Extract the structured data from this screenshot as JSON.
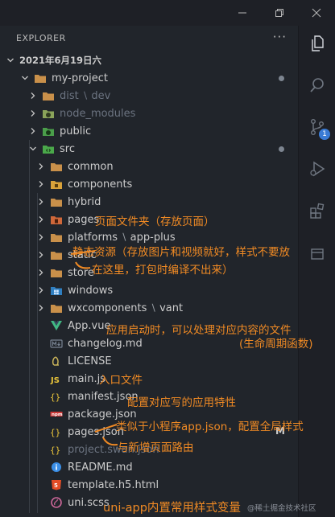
{
  "explorer": {
    "title": "EXPLORER",
    "more": "···",
    "root_label": "2021年6月19日六"
  },
  "window_controls": [
    "minimize",
    "restore",
    "close"
  ],
  "activity_bar": {
    "items": [
      {
        "name": "explorer-icon"
      },
      {
        "name": "search-icon"
      },
      {
        "name": "source-control-icon",
        "badge": "1"
      },
      {
        "name": "run-debug-icon"
      },
      {
        "name": "extensions-icon"
      },
      {
        "name": "remote-icon"
      }
    ]
  },
  "tree": [
    {
      "label": "my-project",
      "type": "folder",
      "expanded": true,
      "depth": 1,
      "dot": true,
      "icon": "folder-orange-icon"
    },
    {
      "label": "dist",
      "label2": "dev",
      "type": "folder",
      "expanded": false,
      "depth": 2,
      "dim": true,
      "icon": "folder-orange-icon"
    },
    {
      "label": "node_modules",
      "type": "folder",
      "expanded": false,
      "depth": 2,
      "dim": true,
      "icon": "folder-node-icon"
    },
    {
      "label": "public",
      "type": "folder",
      "expanded": false,
      "depth": 2,
      "icon": "folder-public-icon"
    },
    {
      "label": "src",
      "type": "folder",
      "expanded": true,
      "depth": 2,
      "dot": true,
      "icon": "folder-src-icon"
    },
    {
      "label": "common",
      "type": "folder",
      "expanded": false,
      "depth": 3,
      "icon": "folder-orange-icon"
    },
    {
      "label": "components",
      "type": "folder",
      "expanded": false,
      "depth": 3,
      "icon": "folder-components-icon"
    },
    {
      "label": "hybrid",
      "type": "folder",
      "expanded": false,
      "depth": 3,
      "icon": "folder-orange-icon"
    },
    {
      "label": "pages",
      "type": "folder",
      "expanded": false,
      "depth": 3,
      "icon": "folder-pages-icon"
    },
    {
      "label": "platforms",
      "label2": "app-plus",
      "type": "folder",
      "expanded": false,
      "depth": 3,
      "icon": "folder-orange-icon"
    },
    {
      "label": "static",
      "type": "folder",
      "expanded": false,
      "depth": 3,
      "icon": "folder-orange-icon"
    },
    {
      "label": "store",
      "type": "folder",
      "expanded": false,
      "depth": 3,
      "icon": "folder-orange-icon"
    },
    {
      "label": "windows",
      "type": "folder",
      "expanded": false,
      "depth": 3,
      "icon": "folder-windows-icon"
    },
    {
      "label": "wxcomponents",
      "label2": "vant",
      "type": "folder",
      "expanded": false,
      "depth": 3,
      "icon": "folder-orange-icon"
    },
    {
      "label": "App.vue",
      "type": "file",
      "depth": 3,
      "icon": "vue-icon"
    },
    {
      "label": "changelog.md",
      "type": "file",
      "depth": 3,
      "icon": "markdown-icon"
    },
    {
      "label": "LICENSE",
      "type": "file",
      "depth": 3,
      "icon": "license-icon"
    },
    {
      "label": "main.js",
      "type": "file",
      "depth": 3,
      "icon": "js-icon"
    },
    {
      "label": "manifest.json",
      "type": "file",
      "depth": 3,
      "icon": "json-icon"
    },
    {
      "label": "package.json",
      "type": "file",
      "depth": 3,
      "icon": "npm-icon"
    },
    {
      "label": "pages.json",
      "type": "file",
      "depth": 3,
      "icon": "json-icon",
      "modified": "M"
    },
    {
      "label": "project.swan.json",
      "type": "file",
      "depth": 3,
      "dim": true,
      "icon": "json-icon"
    },
    {
      "label": "README.md",
      "type": "file",
      "depth": 3,
      "icon": "readme-icon"
    },
    {
      "label": "template.h5.html",
      "type": "file",
      "depth": 3,
      "icon": "html5-icon"
    },
    {
      "label": "uni.scss",
      "type": "file",
      "depth": 3,
      "icon": "sass-icon"
    }
  ],
  "annotations": {
    "pages": "页面文件夹（存放页面）",
    "static_1": "静态资源（存放图片和视频就好，样式不要放",
    "static_2": "在这里，打包时编译不出来）",
    "app_vue_1": "应用启动时，可以处理对应内容的文件",
    "app_vue_2": "(生命周期函数)",
    "main_js": "入口文件",
    "manifest": "配置对应写的应用特性",
    "pages_json_1": "类似于小程序app.json，配置全局样式",
    "pages_json_2": "与新增页面路由",
    "uni_scss": "uni-app内置常用样式变量"
  },
  "watermark": "@稀土掘金技术社区",
  "colors": {
    "annotation": "#f08a24",
    "folder": "#d39a4a",
    "background": "#21252b",
    "badge": "#3a7bd5"
  }
}
